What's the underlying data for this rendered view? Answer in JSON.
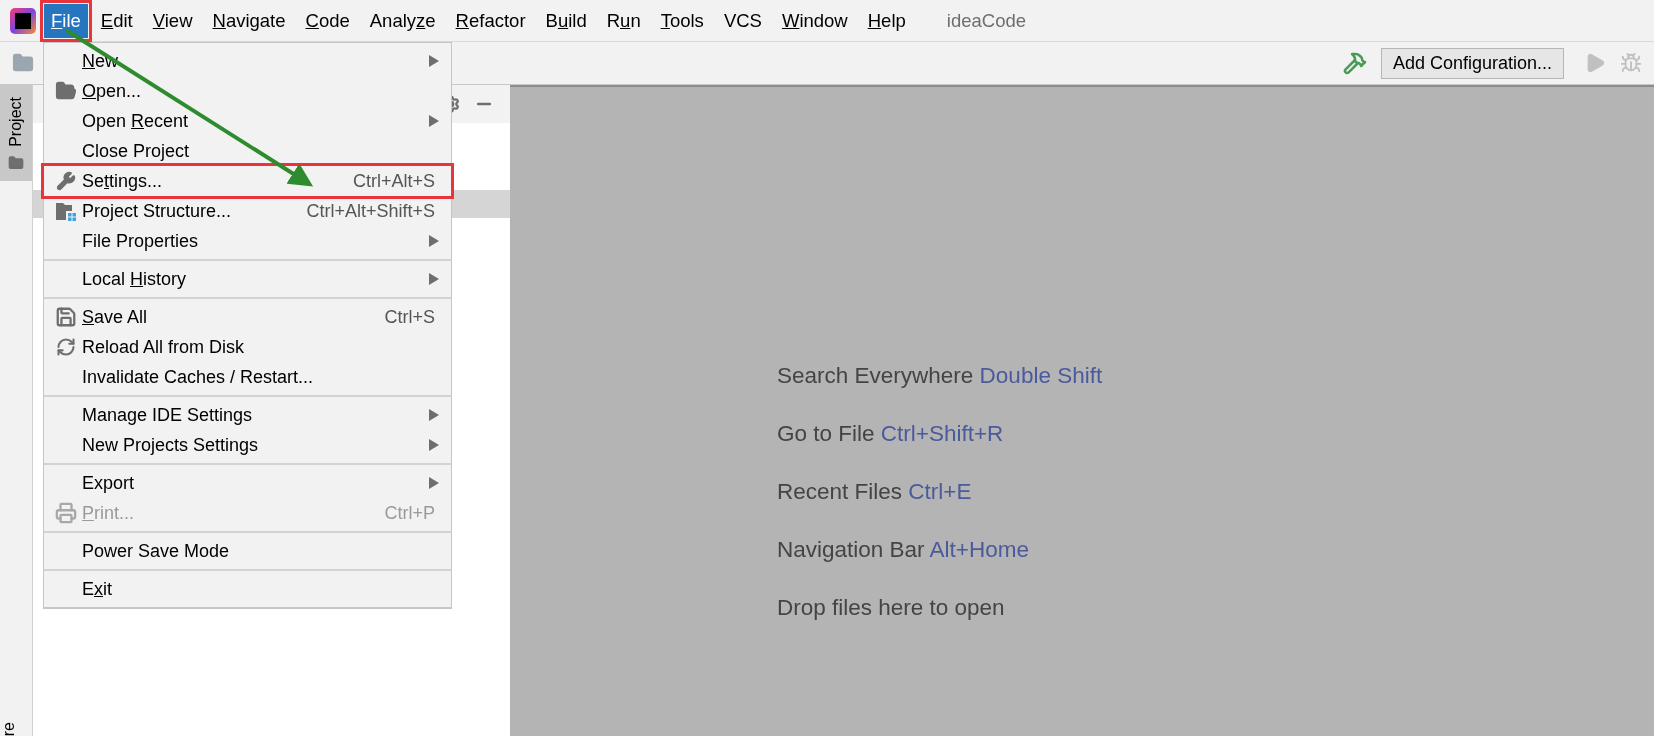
{
  "menubar": {
    "items": [
      {
        "parts": [
          {
            "text": "F",
            "mnemonic": true
          },
          {
            "text": "ile",
            "mnemonic": false
          }
        ],
        "selected": true,
        "annotated": true
      },
      {
        "parts": [
          {
            "text": "E",
            "mnemonic": true
          },
          {
            "text": "dit",
            "mnemonic": false
          }
        ],
        "selected": false,
        "annotated": false
      },
      {
        "parts": [
          {
            "text": "V",
            "mnemonic": true
          },
          {
            "text": "iew",
            "mnemonic": false
          }
        ],
        "selected": false,
        "annotated": false
      },
      {
        "parts": [
          {
            "text": "N",
            "mnemonic": true
          },
          {
            "text": "avigate",
            "mnemonic": false
          }
        ],
        "selected": false,
        "annotated": false
      },
      {
        "parts": [
          {
            "text": "C",
            "mnemonic": true
          },
          {
            "text": "ode",
            "mnemonic": false
          }
        ],
        "selected": false,
        "annotated": false
      },
      {
        "parts": [
          {
            "text": "Analy",
            "mnemonic": false
          },
          {
            "text": "z",
            "mnemonic": true
          },
          {
            "text": "e",
            "mnemonic": false
          }
        ],
        "selected": false,
        "annotated": false
      },
      {
        "parts": [
          {
            "text": "R",
            "mnemonic": true
          },
          {
            "text": "efactor",
            "mnemonic": false
          }
        ],
        "selected": false,
        "annotated": false
      },
      {
        "parts": [
          {
            "text": "B",
            "mnemonic": false
          },
          {
            "text": "u",
            "mnemonic": true
          },
          {
            "text": "ild",
            "mnemonic": false
          }
        ],
        "selected": false,
        "annotated": false
      },
      {
        "parts": [
          {
            "text": "R",
            "mnemonic": false
          },
          {
            "text": "u",
            "mnemonic": true
          },
          {
            "text": "n",
            "mnemonic": false
          }
        ],
        "selected": false,
        "annotated": false
      },
      {
        "parts": [
          {
            "text": "T",
            "mnemonic": true
          },
          {
            "text": "ools",
            "mnemonic": false
          }
        ],
        "selected": false,
        "annotated": false
      },
      {
        "parts": [
          {
            "text": "VCS",
            "mnemonic": false
          }
        ],
        "selected": false,
        "annotated": false
      },
      {
        "parts": [
          {
            "text": "W",
            "mnemonic": true
          },
          {
            "text": "indow",
            "mnemonic": false
          }
        ],
        "selected": false,
        "annotated": false
      },
      {
        "parts": [
          {
            "text": "H",
            "mnemonic": true
          },
          {
            "text": "elp",
            "mnemonic": false
          }
        ],
        "selected": false,
        "annotated": false
      }
    ],
    "project_title": "ideaCode"
  },
  "toolbar": {
    "add_configuration": "Add Configuration..."
  },
  "side_tabs": [
    {
      "label": "Project",
      "selected": true
    }
  ],
  "side_tab_bottom": "re",
  "file_menu": {
    "sections": [
      [
        {
          "parts": [
            {
              "text": "N",
              "mnemonic": true
            },
            {
              "text": "ew",
              "mnemonic": false
            }
          ],
          "submenu": true,
          "disabled": false,
          "annotated": false
        },
        {
          "parts": [
            {
              "text": "O",
              "mnemonic": true
            },
            {
              "text": "pen...",
              "mnemonic": false
            }
          ],
          "submenu": false,
          "disabled": false,
          "annotated": false
        },
        {
          "parts": [
            {
              "text": "Open ",
              "mnemonic": false
            },
            {
              "text": "R",
              "mnemonic": true
            },
            {
              "text": "ecent",
              "mnemonic": false
            }
          ],
          "submenu": true,
          "disabled": false,
          "annotated": false
        },
        {
          "parts": [
            {
              "text": "Close Project",
              "mnemonic": false
            }
          ],
          "submenu": false,
          "disabled": false,
          "annotated": false
        },
        {
          "parts": [
            {
              "text": "Se",
              "mnemonic": false
            },
            {
              "text": "t",
              "mnemonic": true
            },
            {
              "text": "tings...",
              "mnemonic": false
            }
          ],
          "shortcut": "Ctrl+Alt+S",
          "submenu": false,
          "disabled": false,
          "annotated": true
        },
        {
          "parts": [
            {
              "text": "Project Structure...",
              "mnemonic": false
            }
          ],
          "shortcut": "Ctrl+Alt+Shift+S",
          "submenu": false,
          "disabled": false,
          "annotated": false
        },
        {
          "parts": [
            {
              "text": "File Properties",
              "mnemonic": false
            }
          ],
          "submenu": true,
          "disabled": false,
          "annotated": false
        }
      ],
      [
        {
          "parts": [
            {
              "text": "Local ",
              "mnemonic": false
            },
            {
              "text": "H",
              "mnemonic": true
            },
            {
              "text": "istory",
              "mnemonic": false
            }
          ],
          "submenu": true,
          "disabled": false,
          "annotated": false
        }
      ],
      [
        {
          "parts": [
            {
              "text": "S",
              "mnemonic": true
            },
            {
              "text": "ave All",
              "mnemonic": false
            }
          ],
          "shortcut": "Ctrl+S",
          "submenu": false,
          "disabled": false,
          "annotated": false
        },
        {
          "parts": [
            {
              "text": "Reload All from Disk",
              "mnemonic": false
            }
          ],
          "submenu": false,
          "disabled": false,
          "annotated": false
        },
        {
          "parts": [
            {
              "text": "Invalidate Caches / Restart...",
              "mnemonic": false
            }
          ],
          "submenu": false,
          "disabled": false,
          "annotated": false
        }
      ],
      [
        {
          "parts": [
            {
              "text": "Manage IDE Settings",
              "mnemonic": false
            }
          ],
          "submenu": true,
          "disabled": false,
          "annotated": false
        },
        {
          "parts": [
            {
              "text": "New Projects Settings",
              "mnemonic": false
            }
          ],
          "submenu": true,
          "disabled": false,
          "annotated": false
        }
      ],
      [
        {
          "parts": [
            {
              "text": "Export",
              "mnemonic": false
            }
          ],
          "submenu": true,
          "disabled": false,
          "annotated": false
        },
        {
          "parts": [
            {
              "text": "P",
              "mnemonic": true
            },
            {
              "text": "rint...",
              "mnemonic": false
            }
          ],
          "shortcut": "Ctrl+P",
          "submenu": false,
          "disabled": true,
          "annotated": false
        }
      ],
      [
        {
          "parts": [
            {
              "text": "Power Save Mode",
              "mnemonic": false
            }
          ],
          "submenu": false,
          "disabled": false,
          "annotated": false
        }
      ],
      [
        {
          "parts": [
            {
              "text": "E",
              "mnemonic": false
            },
            {
              "text": "x",
              "mnemonic": true
            },
            {
              "text": "it",
              "mnemonic": false
            }
          ],
          "submenu": false,
          "disabled": false,
          "annotated": false
        }
      ]
    ]
  },
  "editor_hints": [
    {
      "label": "Search Everywhere",
      "shortcut": "Double Shift"
    },
    {
      "label": "Go to File",
      "shortcut": "Ctrl+Shift+R"
    },
    {
      "label": "Recent Files",
      "shortcut": "Ctrl+E"
    },
    {
      "label": "Navigation Bar",
      "shortcut": "Alt+Home"
    },
    {
      "label": "Drop files here to open"
    }
  ]
}
